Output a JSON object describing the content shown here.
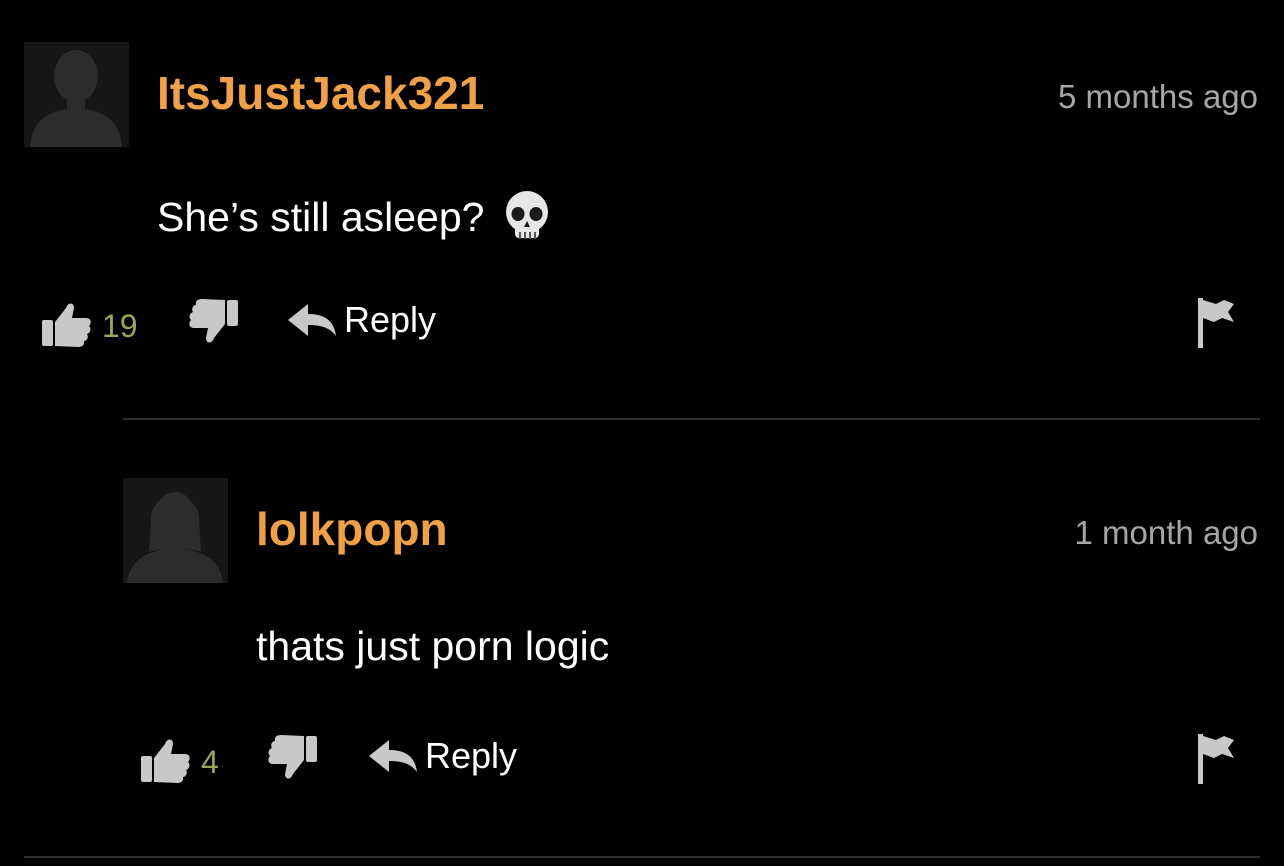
{
  "comments": [
    {
      "username": "ItsJustJack321",
      "timestamp": "5 months ago",
      "text": "She’s still asleep?",
      "emoji": "skull-emoji",
      "likes": "19",
      "reply_label": "Reply",
      "avatar": "default-male-avatar"
    },
    {
      "username": "lolkpopn",
      "timestamp": "1 month ago",
      "text": "thats just porn logic",
      "likes": "4",
      "reply_label": "Reply",
      "avatar": "default-female-avatar"
    }
  ],
  "colors": {
    "background": "#000000",
    "username": "#f0a048",
    "timestamp": "#a6a6a6",
    "like_count": "#9aa55a",
    "icon": "#c8c8c8",
    "divider": "#2e2e2e"
  },
  "icons": [
    "thumbs-up-icon",
    "thumbs-down-icon",
    "reply-arrow-icon",
    "flag-icon",
    "skull-emoji"
  ]
}
